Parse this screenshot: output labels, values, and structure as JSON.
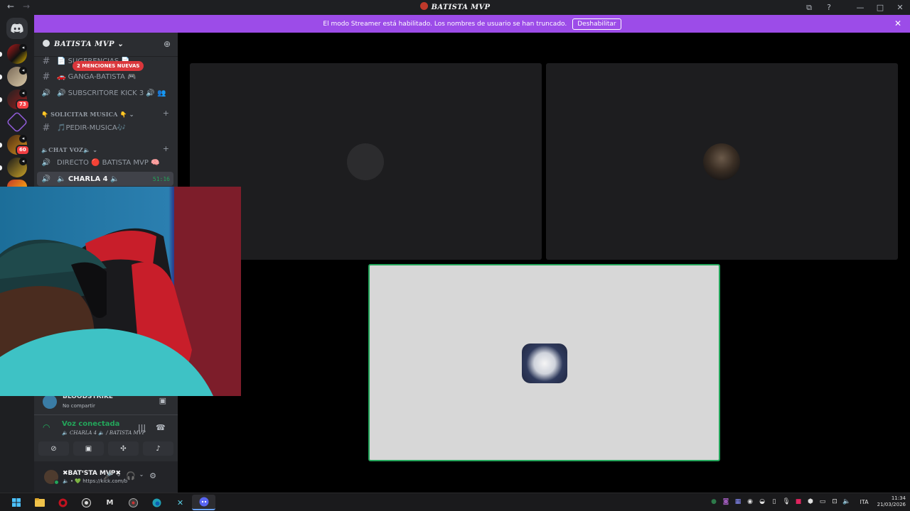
{
  "window": {
    "title": "BATISTA MVP",
    "back_icon": "←",
    "forward_icon": "→",
    "controls": [
      "⧉",
      "?",
      "—",
      "□",
      "✕"
    ]
  },
  "banner": {
    "message": "El modo Streamer está habilitado. Los nombres de usuario se han truncado.",
    "button": "Deshabilitar",
    "close": "✕",
    "color": "#9c4ce8"
  },
  "rail": {
    "badges": [
      "73",
      "60"
    ]
  },
  "guild": {
    "name": "BATISTA MVP",
    "chevron": "⌄",
    "invite_icon": "person-add-icon"
  },
  "channels": {
    "mention_pill": "2 MENCIONES NUEVAS",
    "items": [
      {
        "icon": "#",
        "name": "📄 SUGERENCIAS 📄"
      },
      {
        "icon": "#",
        "name": "🚗 GANGA-BATISTA 🎮"
      },
      {
        "icon": "🔊",
        "name": "🔊 SUBSCRITORE KICK 3 🔊 👥"
      }
    ],
    "cat_musica": "👇 SOLICITAR MUSICA 👇",
    "musica_items": [
      {
        "icon": "#",
        "name": "🎵PEDIR-MUSICA🎶"
      }
    ],
    "cat_voz": "🔈CHAT VOZ🔈",
    "voz_items": [
      {
        "icon": "🔊",
        "name": "DIRECTO 🔴 BATISTA MVP 🧠"
      },
      {
        "icon": "🔊",
        "name": "🔈 CHARLA 4 🔈",
        "time": "51:16"
      }
    ],
    "plus": "+",
    "chev": "⌄"
  },
  "live_user": {
    "name": "BLOODSTRIKE",
    "status": "No compartir"
  },
  "voice": {
    "title": "Voz conectada",
    "subtitle": "🔈 CHARLA 4 🔈 / BATISTA MVP",
    "buttons": [
      "video-off-icon",
      "screen-share-icon",
      "activities-icon",
      "soundboard-icon"
    ]
  },
  "user": {
    "name": "✖BATᶦSTA MVP✖",
    "status_line": "🔈 • 💚 https://kick.com/b",
    "mic_icon": "🎤",
    "headset_icon": "🎧",
    "settings_icon": "⚙",
    "chevron": "⌄"
  },
  "taskbar": {
    "apps": [
      "start-icon",
      "file-explorer-icon",
      "app-red-icon",
      "obs-icon",
      "app-m-icon",
      "app-steam-icon",
      "edge-icon",
      "app-x-icon",
      "discord-icon"
    ],
    "language": "ITA",
    "time": "11:34",
    "date": "21/03/2026"
  }
}
